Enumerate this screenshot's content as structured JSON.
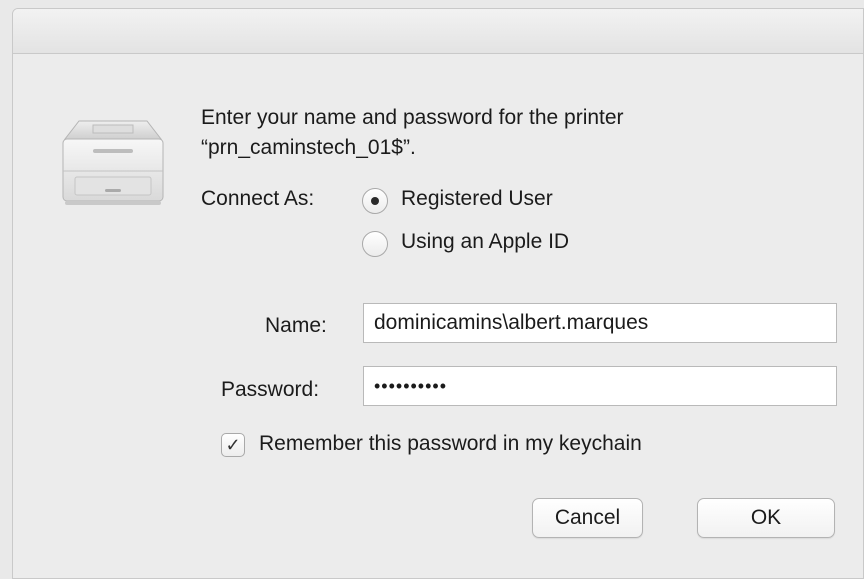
{
  "dialog": {
    "message_line1": "Enter your name and password for the printer",
    "message_line2": "“prn_caminstech_01$”.",
    "icon": "printer-icon"
  },
  "connect_as": {
    "label": "Connect As:",
    "options": [
      {
        "label": "Registered User",
        "selected": true
      },
      {
        "label": "Using an Apple ID",
        "selected": false
      }
    ]
  },
  "form": {
    "name_label": "Name:",
    "name_value": "dominicamins\\albert.marques",
    "password_label": "Password:",
    "password_value": "••••••••••"
  },
  "keychain": {
    "label": "Remember this password in my keychain",
    "checked": true,
    "check_glyph": "✓"
  },
  "buttons": {
    "cancel": "Cancel",
    "ok": "OK"
  }
}
